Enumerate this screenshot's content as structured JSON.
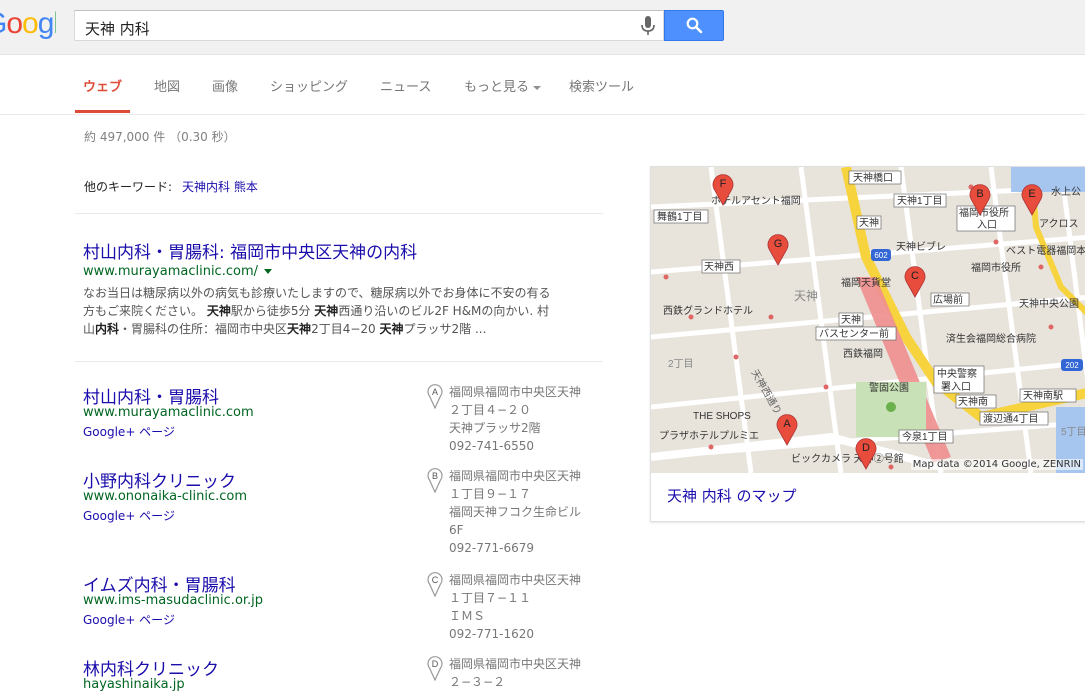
{
  "header": {
    "search_query": "天神 内科"
  },
  "tabs": [
    {
      "label": "ウェブ",
      "active": true
    },
    {
      "label": "地図"
    },
    {
      "label": "画像"
    },
    {
      "label": "ショッピング"
    },
    {
      "label": "ニュース"
    },
    {
      "label": "もっと見る"
    },
    {
      "label": "検索ツール"
    }
  ],
  "result_stats": "約 497,000 件 （0.30 秒）",
  "related": {
    "label": "他のキーワード:",
    "link": "天神内科 熊本"
  },
  "first_result": {
    "title": "村山内科・胃腸科: 福岡市中央区天神の内科",
    "url": "www.murayamaclinic.com/",
    "snippet_1": "なお当日は糖尿病以外の病気も診療いたしますので、糖尿病以外でお身体に不安の有る",
    "snippet_2a": "方もご来院ください。 ",
    "snippet_2b": "天神",
    "snippet_2c": "駅から徒歩5分 ",
    "snippet_2d": "天神",
    "snippet_2e": "西通り沿いのビル2F H&Mの向かい. 村",
    "snippet_3a": "山",
    "snippet_3b": "内科",
    "snippet_3c": "・胃腸科の住所：福岡市中央区",
    "snippet_3d": "天神",
    "snippet_3e": "2丁目4−20 ",
    "snippet_3f": "天神",
    "snippet_3g": "プラッサ2階 ..."
  },
  "local_results": [
    {
      "marker": "A",
      "title": "村山内科・胃腸科",
      "url": "www.murayamaclinic.com",
      "gplus": "Google+ ページ",
      "address": [
        "福岡県福岡市中央区天神",
        "２丁目４−２０",
        "天神プラッサ2階"
      ],
      "phone": "092-741-6550"
    },
    {
      "marker": "B",
      "title": "小野内科クリニック",
      "url": "www.ononaika-clinic.com",
      "gplus": "Google+ ページ",
      "address": [
        "福岡県福岡市中央区天神",
        "１丁目９−１７",
        "福岡天神フコク生命ビル",
        "6F"
      ],
      "phone": "092-771-6679"
    },
    {
      "marker": "C",
      "title": "イムズ内科・胃腸科",
      "url": "www.ims-masudaclinic.or.jp",
      "gplus": "Google+ ページ",
      "address": [
        "福岡県福岡市中央区天神",
        "１丁目７−１１",
        "ＩＭＳ"
      ],
      "phone": "092-771-1620"
    },
    {
      "marker": "D",
      "title": "林内科クリニック",
      "url": "hayashinaika.jp",
      "address": [
        "福岡県福岡市中央区天神",
        "２−３−２"
      ]
    }
  ],
  "map": {
    "link": "天神 内科 のマップ",
    "attribution": "Map data ©2014 Google, ZENRIN",
    "labels": {
      "tenjin_bashi": "天神橋口",
      "hotel_ascent": "ホテルアセント福岡",
      "maizuru": "舞鶴1丁目",
      "tenjin1": "天神1丁目",
      "fukuoka_shiyakusho_iriguchi_1": "福岡市役所",
      "iriguchi": "入口",
      "mizuue": "水上公",
      "acros": "アクロス",
      "tenjin_station": "天神",
      "tenjin_vivre": "天神ビブレ",
      "bestdenki": "ベスト電器福岡本",
      "tenjin_nishi": "天神西",
      "fukuoka_shiyakusho": "福岡市役所",
      "nishitetsu_grand": "西鉄グランドホテル",
      "tenjin_area": "天神",
      "fukuoka_tenjin_ha": "福岡天貨堂",
      "hiroba": "広場前",
      "tenjin_chuo": "天神中央公園",
      "bus_center_1": "天神",
      "bus_center_2": "バスセンター前",
      "saiseikai": "済生会福岡総合病院",
      "nishitetsu_fukuoka": "西鉄福岡",
      "nichome": "2丁目",
      "tenjin_nishidori": "天神西通り",
      "keigo": "警固公園",
      "chuo_keisatsu": "中央警察",
      "iriguchi2": "署入口",
      "tenjin_minami": "天神南",
      "tenjin_minami_eki": "天神南駅",
      "watanabe": "渡辺通4丁目",
      "shops": "THE SHOPS",
      "plaza_hotel": "プラザホテルプルミエ",
      "imaizumi": "今泉1丁目",
      "bic": "ビックカメラ 天神②号館",
      "road_202": "202",
      "road_602": "602",
      "five": "5丁目"
    }
  }
}
